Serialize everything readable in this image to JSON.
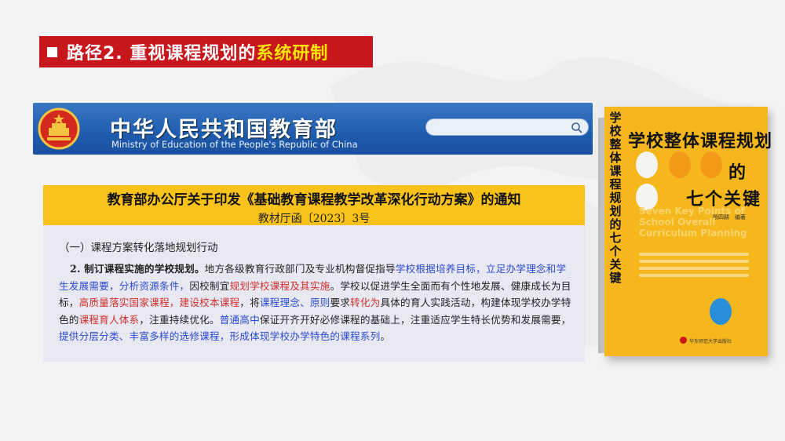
{
  "slide": {
    "title_prefix": "路径2. 重视课程规划的",
    "title_highlight": "系统研制"
  },
  "ministry": {
    "name_cn": "中华人民共和国教育部",
    "name_en": "Ministry of Education of the People's Republic of China"
  },
  "notice": {
    "title": "教育部办公厅关于印发《基础教育课程教学改革深化行动方案》的通知",
    "doc_number": "教材厅函〔2023〕3号",
    "section_heading": "（一）课程方案转化落地规划行动",
    "paragraph": {
      "s1": "2. 制订课程实施的学校规划。",
      "s2": "地方各级教育行政部门及专业机构督促指导",
      "s3": "学校根据培养目标，立足办学理念和学生发展需要，分析资源条件，",
      "s4": "因校制宜",
      "s5": "规划学校课程及其实施",
      "s6": "。学校以促进学生全面而有个性地发展、健康成长为目标，",
      "s7": "高质量落实国家课程，建设校本课程",
      "s8": "，将",
      "s9": "课程理念、原则",
      "s10": "要求",
      "s11": "转化为",
      "s12": "具体的育人实践活动，构建体现学校办学特色的",
      "s13": "课程育人体系",
      "s14": "，注重持续优化。",
      "s15": "普通高中",
      "s16": "保证开齐开好必修课程的基础上，注重适应学生特长优势和发展需要，",
      "s17": "提供分层分类、丰富多样的选修课程，形成体现学校办学特色的课程系列",
      "s18": "。"
    }
  },
  "book": {
    "spine": "学校整体课程规划的七个关键",
    "title_line1": "学校整体课程规划",
    "title_line2": "的",
    "title_line3": "七个关键",
    "author": "杨四耕　编著",
    "english": "Seven Key Points of School Overall Curriculum Planning",
    "publisher": "华东师范大学出版社"
  },
  "colors": {
    "title_red": "#c8161d",
    "highlight_yellow": "#ffe600",
    "notice_header": "#f9c21b",
    "text_blue": "#2a4bd0",
    "text_red": "#d0302c",
    "book_cover": "#f5b71c"
  },
  "icons": {
    "search": "search-icon",
    "emblem": "national-emblem-icon"
  }
}
